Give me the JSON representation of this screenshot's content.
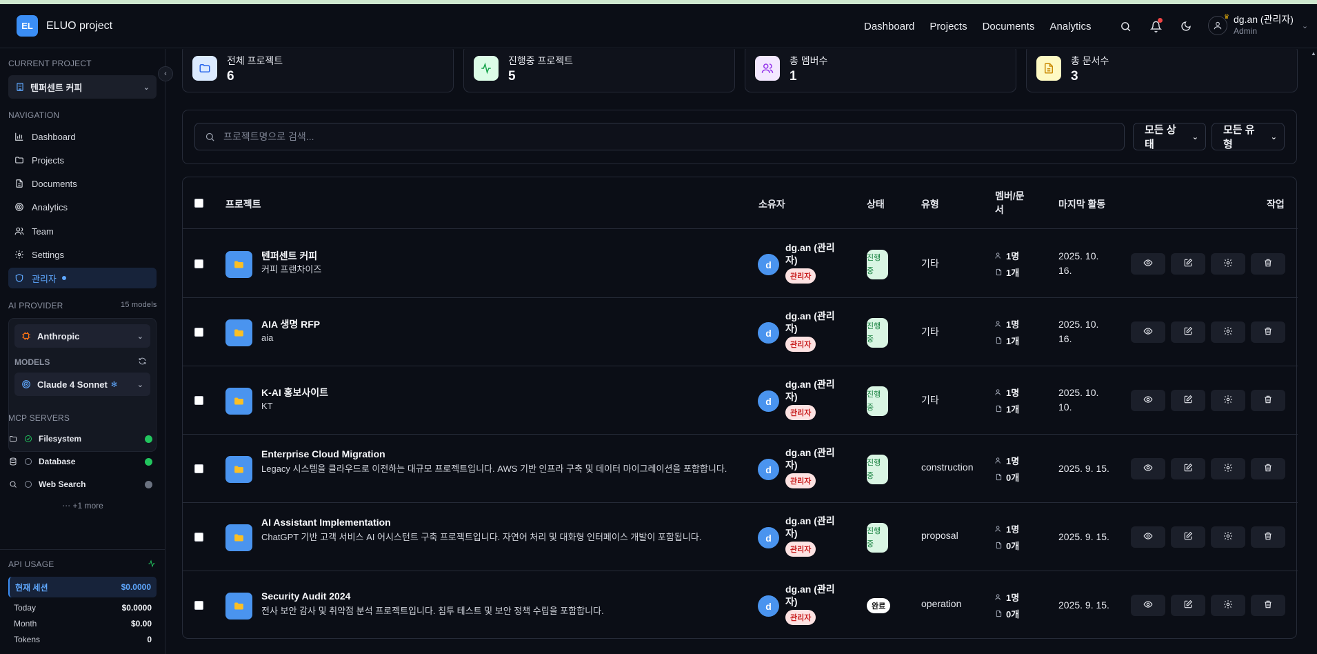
{
  "app": {
    "logo": "EL",
    "title": "ELUO project"
  },
  "topnav": [
    "Dashboard",
    "Projects",
    "Documents",
    "Analytics"
  ],
  "user": {
    "name": "dg.an (관리자)",
    "role": "Admin"
  },
  "icons": {
    "search": "search-icon",
    "bell": "bell-icon",
    "theme": "moon-icon",
    "user": "user-icon"
  },
  "sidebar": {
    "current_project_label": "CURRENT PROJECT",
    "current_project": "텐퍼센트 커피",
    "navigation_label": "NAVIGATION",
    "nav": [
      {
        "label": "Dashboard",
        "icon": "bar-chart-icon"
      },
      {
        "label": "Projects",
        "icon": "folder-icon"
      },
      {
        "label": "Documents",
        "icon": "document-icon"
      },
      {
        "label": "Analytics",
        "icon": "target-icon"
      },
      {
        "label": "Team",
        "icon": "users-icon"
      },
      {
        "label": "Settings",
        "icon": "gear-icon"
      },
      {
        "label": "관리자",
        "icon": "shield-icon",
        "active": true
      }
    ],
    "ai_provider_label": "AI PROVIDER",
    "models_count": "15 models",
    "provider": "Anthropic",
    "models_label": "MODELS",
    "model": "Claude 4 Sonnet",
    "mcp_label": "MCP SERVERS",
    "mcp": [
      {
        "name": "Filesystem",
        "status_color": "#22c55e",
        "connected": true
      },
      {
        "name": "Database",
        "status_color": "#22c55e",
        "connected": false
      },
      {
        "name": "Web Search",
        "status_color": "#6b7280",
        "connected": false
      }
    ],
    "more": "+1 more",
    "api_usage_label": "API USAGE",
    "session": {
      "label": "현재 세션",
      "value": "$0.0000"
    },
    "usage": [
      {
        "label": "Today",
        "value": "$0.0000"
      },
      {
        "label": "Month",
        "value": "$0.00"
      },
      {
        "label": "Tokens",
        "value": "0"
      }
    ]
  },
  "stats": [
    {
      "label": "전체 프로젝트",
      "value": "6",
      "icon": "folder-icon",
      "bg": "#dbeafe",
      "color": "#2563eb"
    },
    {
      "label": "진행중 프로젝트",
      "value": "5",
      "icon": "activity-icon",
      "bg": "#dcfce7",
      "color": "#16a34a"
    },
    {
      "label": "총 멤버수",
      "value": "1",
      "icon": "users-icon",
      "bg": "#f3e8ff",
      "color": "#9333ea"
    },
    {
      "label": "총 문서수",
      "value": "3",
      "icon": "document-icon",
      "bg": "#fef9c3",
      "color": "#ca8a04"
    }
  ],
  "filters": {
    "search_placeholder": "프로젝트명으로 검색...",
    "status": "모든 상태",
    "type": "모든 유형"
  },
  "table": {
    "headers": {
      "project": "프로젝트",
      "owner": "소유자",
      "status": "상태",
      "type": "유형",
      "members_docs_1": "멤버/문",
      "members_docs_2": "서",
      "last_activity": "마지막 활동",
      "actions": "작업"
    },
    "rows": [
      {
        "title": "텐퍼센트 커피",
        "desc": "커피 프랜차이즈",
        "owner_initial": "d",
        "owner_1": "dg.an (관리",
        "owner_2": "자)",
        "role": "관리자",
        "status_1": "진행",
        "status_2": "중",
        "type": "기타",
        "members": "1명",
        "docs": "1개",
        "date_1": "2025. 10.",
        "date_2": "16."
      },
      {
        "title": "AIA 생명 RFP",
        "desc": "aia",
        "owner_initial": "d",
        "owner_1": "dg.an (관리",
        "owner_2": "자)",
        "role": "관리자",
        "status_1": "진행",
        "status_2": "중",
        "type": "기타",
        "members": "1명",
        "docs": "1개",
        "date_1": "2025. 10.",
        "date_2": "16."
      },
      {
        "title": "K-AI 홍보사이트",
        "desc": "KT",
        "owner_initial": "d",
        "owner_1": "dg.an (관리",
        "owner_2": "자)",
        "role": "관리자",
        "status_1": "진행",
        "status_2": "중",
        "type": "기타",
        "members": "1명",
        "docs": "1개",
        "date_1": "2025. 10.",
        "date_2": "10."
      },
      {
        "title": "Enterprise Cloud Migration",
        "desc": "Legacy 시스템을 클라우드로 이전하는 대규모 프로젝트입니다. AWS 기반 인프라 구축 및 데이터 마이그레이션을 포함합니다.",
        "owner_initial": "d",
        "owner_1": "dg.an (관리",
        "owner_2": "자)",
        "role": "관리자",
        "status_1": "진행",
        "status_2": "중",
        "type": "construction",
        "members": "1명",
        "docs": "0개",
        "date_1": "2025. 9. 15.",
        "date_2": ""
      },
      {
        "title": "AI Assistant Implementation",
        "desc": "ChatGPT 기반 고객 서비스 AI 어시스턴트 구축 프로젝트입니다. 자연어 처리 및 대화형 인터페이스 개발이 포함됩니다.",
        "owner_initial": "d",
        "owner_1": "dg.an (관리",
        "owner_2": "자)",
        "role": "관리자",
        "status_1": "진행",
        "status_2": "중",
        "type": "proposal",
        "members": "1명",
        "docs": "0개",
        "date_1": "2025. 9. 15.",
        "date_2": ""
      },
      {
        "title": "Security Audit 2024",
        "desc": "전사 보안 감사 및 취약점 분석 프로젝트입니다. 침투 테스트 및 보안 정책 수립을 포함합니다.",
        "owner_initial": "d",
        "owner_1": "dg.an (관리",
        "owner_2": "자)",
        "role": "관리자",
        "status_done": "완료",
        "type": "operation",
        "members": "1명",
        "docs": "0개",
        "date_1": "2025. 9. 15.",
        "date_2": ""
      }
    ]
  }
}
